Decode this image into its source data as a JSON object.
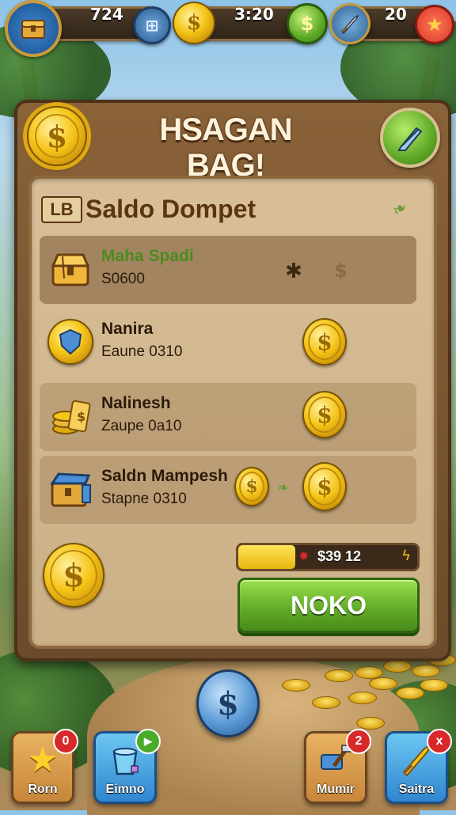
{
  "hud": {
    "gems": "724",
    "time": "3:20",
    "weapons": "20"
  },
  "panel": {
    "title": "HSAGAN BAG!",
    "section_badge": "LB",
    "section_title": "Saldo Dompet"
  },
  "items": [
    {
      "name": "Maha Spadi",
      "sub": "S0600"
    },
    {
      "name": "Nanira",
      "sub": "Eaune 0310"
    },
    {
      "name": "Nalinesh",
      "sub": "Zaupe 0a10"
    },
    {
      "name": "Saldn Mampesh",
      "sub": "Stapne 0310"
    }
  ],
  "progress": {
    "label": "$39 12",
    "fraction": 0.32
  },
  "action_button": "NOKO",
  "nav": [
    {
      "label": "Rorn",
      "badge": "0"
    },
    {
      "label": "Eimno",
      "badge": ""
    },
    {
      "label": "Mumir",
      "badge": "2"
    },
    {
      "label": "Saitra",
      "badge": "x"
    }
  ],
  "colors": {
    "panel_wood": "#8a6238",
    "inner_parchment": "#d8bf98",
    "accent_green": "#5fa827",
    "coin_gold": "#f5c518",
    "badge_red": "#d8282a"
  }
}
